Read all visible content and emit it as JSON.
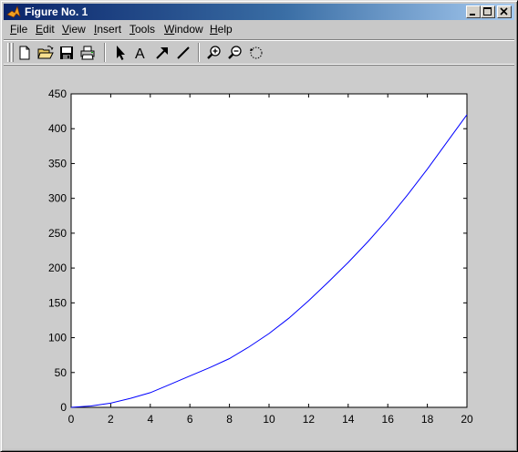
{
  "window": {
    "title": "Figure No. 1"
  },
  "menu": {
    "items": [
      {
        "label_u": "F",
        "label_rest": "ile"
      },
      {
        "label_u": "E",
        "label_rest": "dit"
      },
      {
        "label_u": "V",
        "label_rest": "iew"
      },
      {
        "label_u": "I",
        "label_rest": "nsert"
      },
      {
        "label_u": "T",
        "label_rest": "ools"
      },
      {
        "label_u": "W",
        "label_rest": "indow"
      },
      {
        "label_u": "H",
        "label_rest": "elp"
      }
    ]
  },
  "toolbar": {
    "tools": [
      "new-file-icon",
      "open-folder-icon",
      "save-disk-icon",
      "print-icon",
      "select-arrow-icon",
      "insert-text-icon",
      "insert-arrow-icon",
      "insert-line-icon",
      "zoom-in-icon",
      "zoom-out-icon",
      "rotate-icon"
    ]
  },
  "colors": {
    "line": "#0000ff",
    "axes_bg": "#ffffff",
    "figure_bg": "#cccccc"
  },
  "chart_data": {
    "type": "line",
    "title": "",
    "xlabel": "",
    "ylabel": "",
    "xlim": [
      0,
      20
    ],
    "ylim": [
      0,
      450
    ],
    "xticks": [
      "0",
      "2",
      "4",
      "6",
      "8",
      "10",
      "12",
      "14",
      "16",
      "18",
      "20"
    ],
    "yticks": [
      "0",
      "50",
      "100",
      "150",
      "200",
      "250",
      "300",
      "350",
      "400",
      "450"
    ],
    "grid": false,
    "series": [
      {
        "x": [
          0,
          1,
          2,
          3,
          4,
          5,
          6,
          7,
          8,
          9,
          10,
          11,
          12,
          13,
          14,
          15,
          16,
          17,
          18,
          19,
          20
        ],
        "y": [
          0,
          2,
          6,
          13,
          21,
          33,
          45,
          57,
          70,
          87,
          106,
          128,
          153,
          180,
          208,
          238,
          270,
          305,
          342,
          381,
          420
        ]
      }
    ]
  }
}
